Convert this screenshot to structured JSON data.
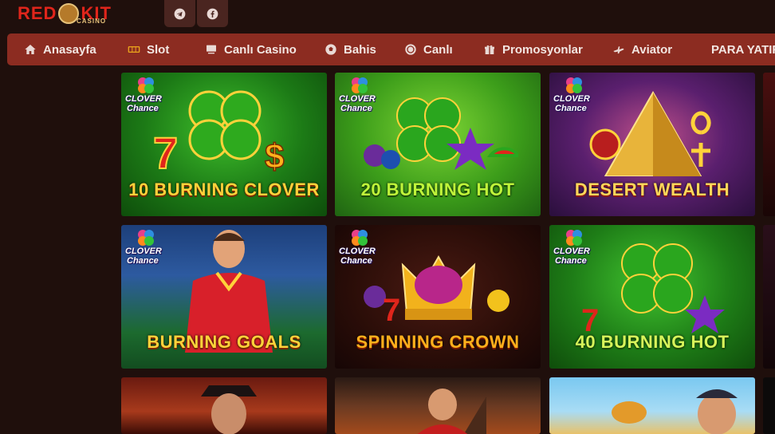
{
  "header": {
    "logo_text_left": "RED",
    "logo_text_right": "KIT",
    "logo_sub": "CASINO",
    "social": [
      {
        "icon": "telegram-icon"
      },
      {
        "icon": "facebook-icon"
      }
    ]
  },
  "nav": {
    "items": [
      {
        "label": "Anasayfa",
        "icon": "home-icon"
      },
      {
        "label": "Slot",
        "icon": "slot-icon"
      },
      {
        "label": "Canlı Casino",
        "icon": "live-casino-icon"
      },
      {
        "label": "Bahis",
        "icon": "soccer-ball-icon"
      },
      {
        "label": "Canlı",
        "icon": "live-icon"
      },
      {
        "label": "Promosyonlar",
        "icon": "gift-icon"
      },
      {
        "label": "Aviator",
        "icon": "plane-icon"
      },
      {
        "label": "PARA YATIR",
        "icon": ""
      }
    ]
  },
  "games": [
    {
      "title": "10 BURNING CLOVER",
      "brand": true,
      "brand_line1": "CLOVER",
      "brand_line2": "Chance"
    },
    {
      "title": "20 BURNING HOT",
      "brand": true,
      "brand_line1": "CLOVER",
      "brand_line2": "Chance"
    },
    {
      "title": "DESERT WEALTH",
      "brand": true,
      "brand_line1": "CLOVER",
      "brand_line2": "Chance"
    },
    {
      "title": "BURNING GOALS",
      "brand": true,
      "brand_line1": "CLOVER",
      "brand_line2": "Chance"
    },
    {
      "title": "SPINNING CROWN",
      "brand": true,
      "brand_line1": "CLOVER",
      "brand_line2": "Chance"
    },
    {
      "title": "40 BURNING HOT",
      "brand": true,
      "brand_line1": "CLOVER",
      "brand_line2": "Chance"
    },
    {
      "title": "",
      "brand": false
    },
    {
      "title": "",
      "brand": false
    },
    {
      "title": "",
      "brand": false
    }
  ],
  "colors": {
    "background": "#1f0f0c",
    "nav": "#8c2c21",
    "social_bg": "#4a2520",
    "accent_gold": "#ffd23a",
    "logo_red": "#e0251b"
  }
}
